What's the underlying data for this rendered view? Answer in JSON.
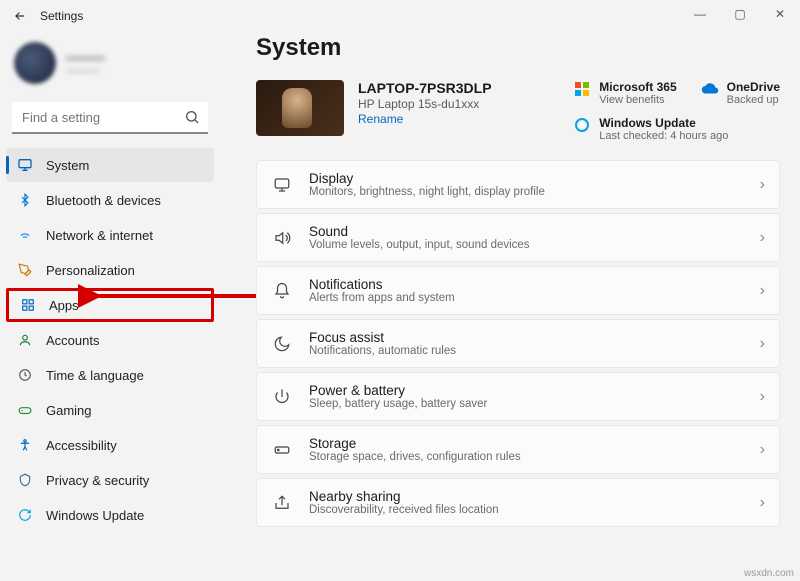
{
  "window": {
    "title": "Settings"
  },
  "user": {
    "name": "———",
    "email": "———"
  },
  "search": {
    "placeholder": "Find a setting"
  },
  "sidebar": {
    "items": [
      {
        "label": "System"
      },
      {
        "label": "Bluetooth & devices"
      },
      {
        "label": "Network & internet"
      },
      {
        "label": "Personalization"
      },
      {
        "label": "Apps"
      },
      {
        "label": "Accounts"
      },
      {
        "label": "Time & language"
      },
      {
        "label": "Gaming"
      },
      {
        "label": "Accessibility"
      },
      {
        "label": "Privacy & security"
      },
      {
        "label": "Windows Update"
      }
    ]
  },
  "page": {
    "heading": "System",
    "device": {
      "name": "LAPTOP-7PSR3DLP",
      "model": "HP Laptop 15s-du1xxx",
      "rename": "Rename"
    },
    "cards": {
      "m365": {
        "title": "Microsoft 365",
        "sub": "View benefits"
      },
      "onedrive": {
        "title": "OneDrive",
        "sub": "Backed up"
      },
      "wu": {
        "title": "Windows Update",
        "sub": "Last checked: 4 hours ago"
      }
    },
    "rows": [
      {
        "title": "Display",
        "desc": "Monitors, brightness, night light, display profile"
      },
      {
        "title": "Sound",
        "desc": "Volume levels, output, input, sound devices"
      },
      {
        "title": "Notifications",
        "desc": "Alerts from apps and system"
      },
      {
        "title": "Focus assist",
        "desc": "Notifications, automatic rules"
      },
      {
        "title": "Power & battery",
        "desc": "Sleep, battery usage, battery saver"
      },
      {
        "title": "Storage",
        "desc": "Storage space, drives, configuration rules"
      },
      {
        "title": "Nearby sharing",
        "desc": "Discoverability, received files location"
      }
    ]
  },
  "watermark": "wsxdn.com"
}
